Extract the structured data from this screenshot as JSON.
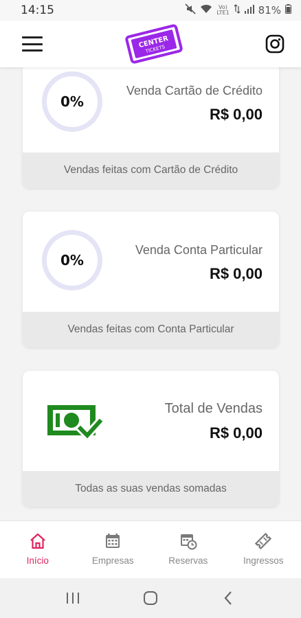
{
  "status_bar": {
    "time": "14:15",
    "network_line1": "Vo)",
    "network_line2": "LTE1",
    "battery": "81%"
  },
  "app_bar": {
    "logo_text_top": "CENTER",
    "logo_text_bottom": "TICKETS",
    "brand_color": "#9b27e8"
  },
  "cards": [
    {
      "percent": "0%",
      "label": "Venda Cartão de Crédito",
      "value": "R$ 0,00",
      "footer": "Vendas feitas com Cartão de Crédito"
    },
    {
      "percent": "0%",
      "label": "Venda Conta Particular",
      "value": "R$ 0,00",
      "footer": "Vendas feitas com Conta Particular"
    },
    {
      "icon": "money-check-icon",
      "icon_color": "#1f8a1f",
      "label": "Total de Vendas",
      "value": "R$ 0,00",
      "footer": "Todas as suas vendas somadas"
    }
  ],
  "bottom_nav": [
    {
      "label": "Início",
      "icon": "home-icon",
      "active": true
    },
    {
      "label": "Empresas",
      "icon": "calendar-icon",
      "active": false
    },
    {
      "label": "Reservas",
      "icon": "calendar-clock-icon",
      "active": false
    },
    {
      "label": "Ingressos",
      "icon": "ticket-icon",
      "active": false
    }
  ],
  "accent_color": "#e0245e"
}
